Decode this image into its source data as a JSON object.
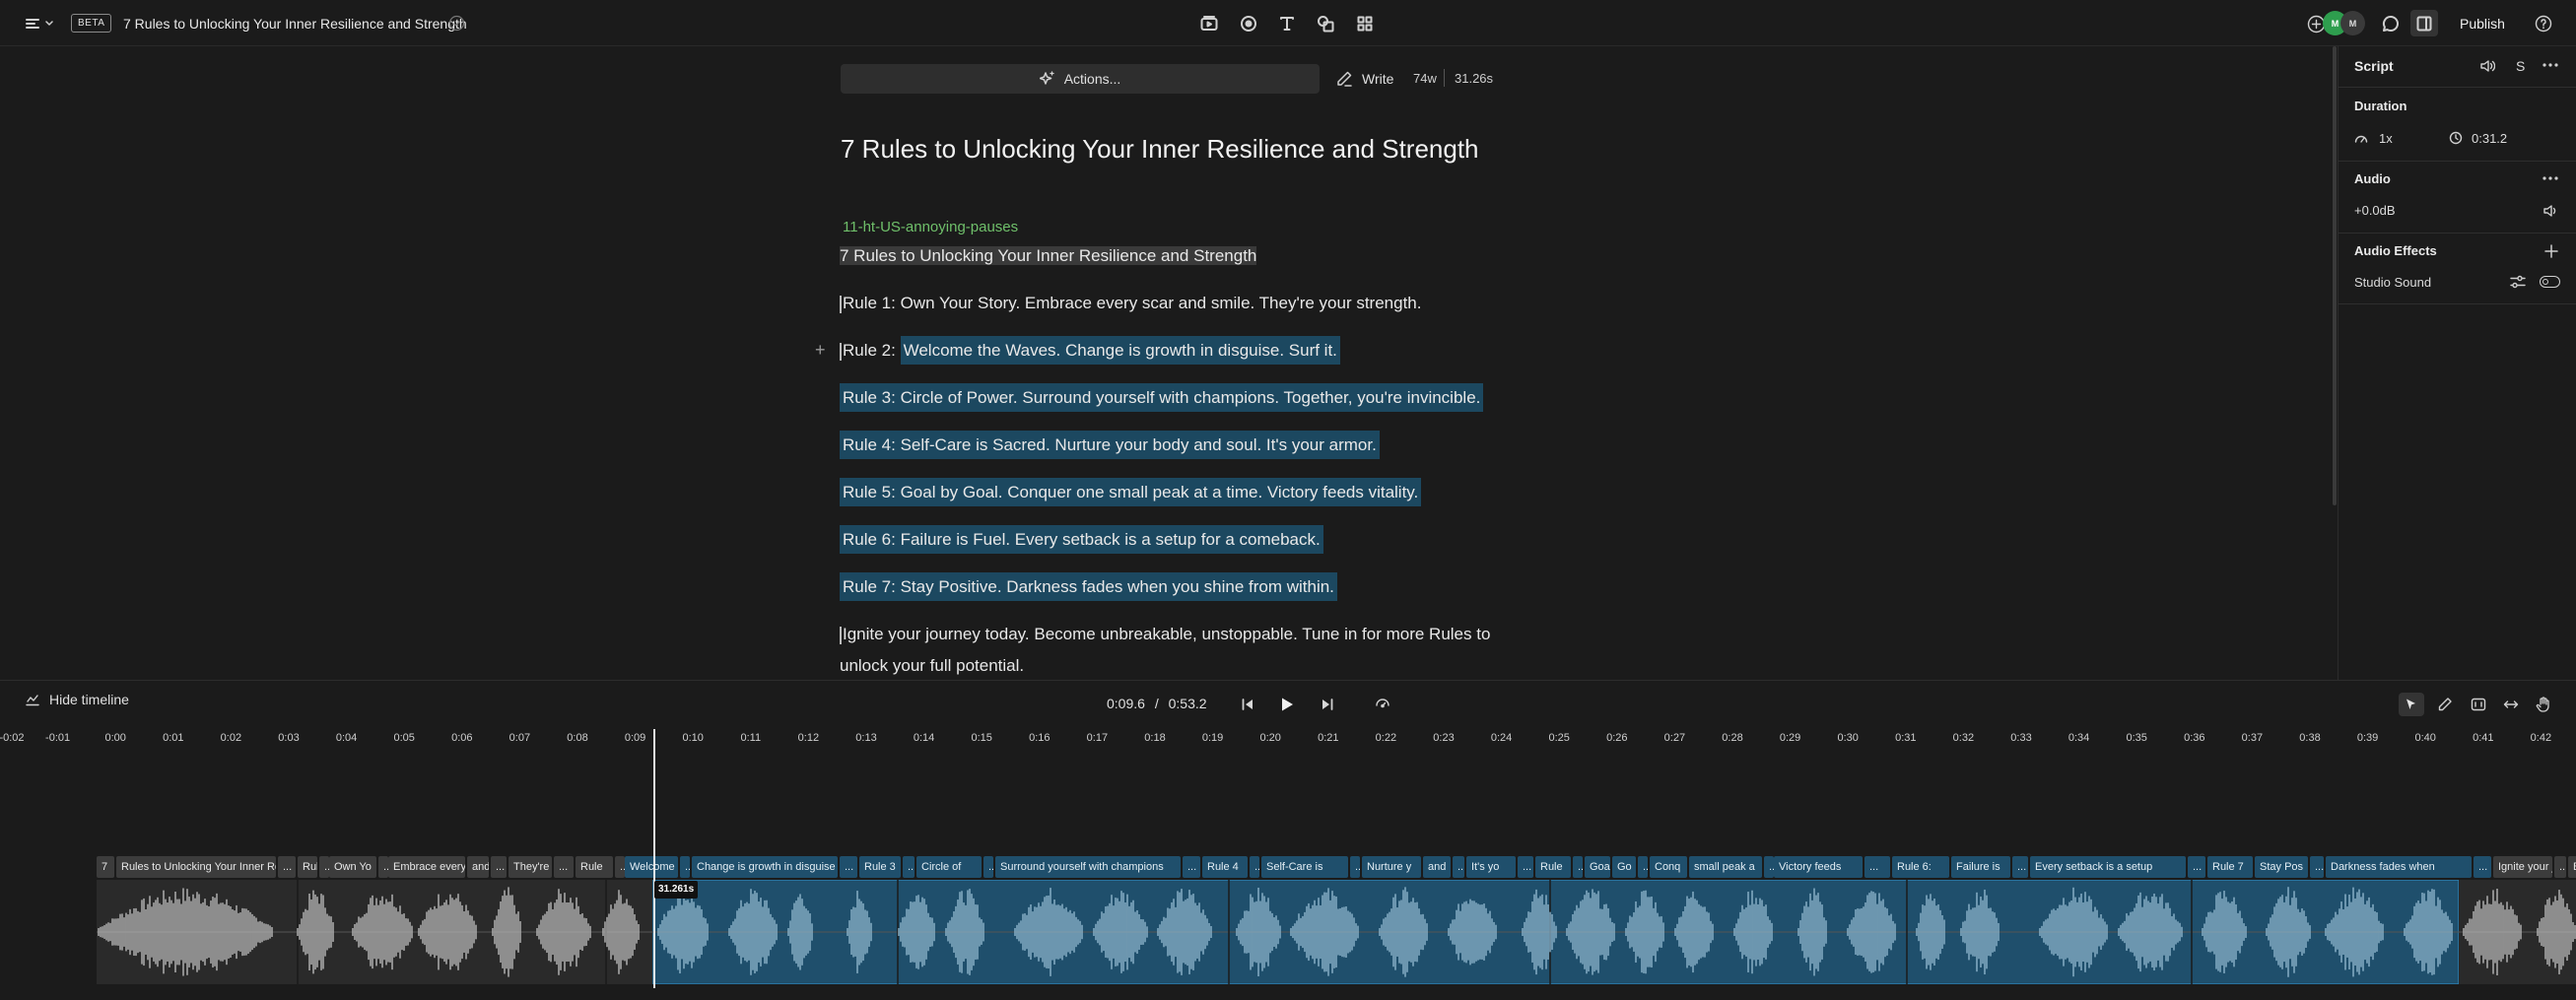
{
  "header": {
    "beta_badge": "BETA",
    "doc_title": "7 Rules to Unlocking Your Inner Resilience and Strength",
    "avatars": [
      {
        "initials": "M",
        "color": "#2e9e4e"
      },
      {
        "initials": "M",
        "color": "#3a3a3a"
      }
    ],
    "publish_label": "Publish"
  },
  "editor": {
    "actions_label": "Actions...",
    "write_label": "Write",
    "word_count": "74w",
    "duration": "31.26s",
    "title": "7 Rules to Unlocking Your Inner Resilience and Strength",
    "speaker": "11-ht-US-annoying-pauses",
    "paragraphs": [
      {
        "text": "7 Rules to Unlocking Your Inner Resilience and Strength",
        "highlighted": false
      },
      {
        "text": "Rule 1: Own Your Story. Embrace every scar and smile. They're your strength.",
        "highlighted": false
      },
      {
        "prefix": "Rule 2: ",
        "text": "Welcome the Waves. Change is growth in disguise. Surf it.",
        "highlighted": true
      },
      {
        "text": "Rule 3: Circle of Power. Surround yourself with champions. Together, you're invincible.",
        "highlighted": true
      },
      {
        "text": "Rule 4: Self-Care is Sacred. Nurture your body and soul. It's your armor.",
        "highlighted": true
      },
      {
        "text": "Rule 5: Goal by Goal. Conquer one small peak at a time. Victory feeds vitality.",
        "highlighted": true
      },
      {
        "text": "Rule 6: Failure is Fuel. Every setback is a setup for a comeback.",
        "highlighted": true
      },
      {
        "text": "Rule 7: Stay Positive. Darkness fades when you shine from within.",
        "highlighted": true
      },
      {
        "line1": "Ignite your journey today. Become unbreakable, unstoppable. Tune in for more Rules to",
        "line2": "unlock your full potential.",
        "highlighted": false
      }
    ]
  },
  "panel": {
    "script_label": "Script",
    "s_label": "S",
    "duration_heading": "Duration",
    "speed": "1x",
    "length": "0:31.2",
    "audio_heading": "Audio",
    "gain": "+0.0dB",
    "effects_heading": "Audio Effects",
    "studio_sound": "Studio Sound"
  },
  "timeline": {
    "hide_label": "Hide timeline",
    "current_time": "0:09.6",
    "separator": "/",
    "total_time": "0:53.2",
    "playhead_label": "31.261s",
    "ruler_ticks": [
      "-0:02",
      "-0:01",
      "0:00",
      "0:01",
      "0:02",
      "0:03",
      "0:04",
      "0:05",
      "0:06",
      "0:07",
      "0:08",
      "0:09",
      "0:10",
      "0:11",
      "0:12",
      "0:13",
      "0:14",
      "0:15",
      "0:16",
      "0:17",
      "0:18",
      "0:19",
      "0:20",
      "0:21",
      "0:22",
      "0:23",
      "0:24",
      "0:25",
      "0:26",
      "0:27",
      "0:28",
      "0:29",
      "0:30",
      "0:31",
      "0:32",
      "0:33",
      "0:34",
      "0:35",
      "0:36",
      "0:37",
      "0:38",
      "0:39",
      "0:40",
      "0:41",
      "0:42"
    ],
    "words": [
      {
        "t": "7",
        "s": false
      },
      {
        "t": "Rules to Unlocking Your Inner Resilience",
        "s": false
      },
      {
        "t": "...",
        "s": false
      },
      {
        "t": "Rul",
        "s": false
      },
      {
        "t": "...",
        "s": false
      },
      {
        "t": "Own Yo",
        "s": false
      },
      {
        "t": "...",
        "s": false
      },
      {
        "t": "Embrace every",
        "s": false
      },
      {
        "t": "and",
        "s": false
      },
      {
        "t": "...",
        "s": false
      },
      {
        "t": "They're",
        "s": false
      },
      {
        "t": "...",
        "s": false
      },
      {
        "t": "Rule",
        "s": false
      },
      {
        "t": "...",
        "s": false
      },
      {
        "t": "Welcome",
        "s": true
      },
      {
        "t": "...",
        "s": true
      },
      {
        "t": "Change is growth in disguise",
        "s": true
      },
      {
        "t": "...",
        "s": true
      },
      {
        "t": "Rule 3",
        "s": true
      },
      {
        "t": "...",
        "s": true
      },
      {
        "t": "Circle of",
        "s": true
      },
      {
        "t": "...",
        "s": true
      },
      {
        "t": "Surround yourself with champions",
        "s": true
      },
      {
        "t": "...",
        "s": true
      },
      {
        "t": "Rule 4",
        "s": true
      },
      {
        "t": "...",
        "s": true
      },
      {
        "t": "Self-Care is",
        "s": true
      },
      {
        "t": "...",
        "s": true
      },
      {
        "t": "Nurture y",
        "s": true
      },
      {
        "t": "and",
        "s": true
      },
      {
        "t": "...",
        "s": true
      },
      {
        "t": "It's yo",
        "s": true
      },
      {
        "t": "...",
        "s": true
      },
      {
        "t": "Rule",
        "s": true
      },
      {
        "t": "...",
        "s": true
      },
      {
        "t": "Goa",
        "s": true
      },
      {
        "t": "Go",
        "s": true
      },
      {
        "t": "...",
        "s": true
      },
      {
        "t": "Conq",
        "s": true
      },
      {
        "t": "small peak a",
        "s": true
      },
      {
        "t": "...",
        "s": true
      },
      {
        "t": "Victory feeds",
        "s": true
      },
      {
        "t": "...",
        "s": true
      },
      {
        "t": "Rule 6:",
        "s": true
      },
      {
        "t": "Failure is",
        "s": true
      },
      {
        "t": "...",
        "s": true
      },
      {
        "t": "Every setback is a setup",
        "s": true
      },
      {
        "t": "...",
        "s": true
      },
      {
        "t": "Rule 7",
        "s": true
      },
      {
        "t": "Stay Pos",
        "s": true
      },
      {
        "t": "...",
        "s": true
      },
      {
        "t": "Darkness fades when",
        "s": true
      },
      {
        "t": "...",
        "s": true
      },
      {
        "t": "Ignite your jo",
        "s": false
      },
      {
        "t": "...",
        "s": false
      },
      {
        "t": "Be",
        "s": false
      }
    ]
  },
  "colors": {
    "background": "#1b1b1b",
    "selection": "#1c4860",
    "selection_track": "#1f4f6c",
    "wave_selected": "#8fb6cc",
    "wave_unselected": "#b8b8b8",
    "speaker_green": "#6fbf6a"
  }
}
